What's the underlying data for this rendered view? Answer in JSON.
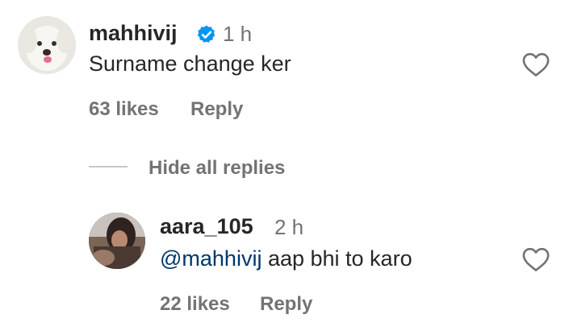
{
  "comment": {
    "username": "mahhivij",
    "verified": true,
    "time": "1 h",
    "text": "Surname change ker",
    "likes": "63 likes",
    "reply_label": "Reply"
  },
  "replies_toggle": {
    "label": "Hide all replies"
  },
  "reply": {
    "username": "aara_105",
    "time": "2 h",
    "mention": "@mahhivij",
    "text": " aap bhi to karo",
    "likes": "22 likes",
    "reply_label": "Reply"
  },
  "colors": {
    "verified_badge": "#0095f6",
    "mention": "#00376b",
    "meta_text": "#737373"
  }
}
